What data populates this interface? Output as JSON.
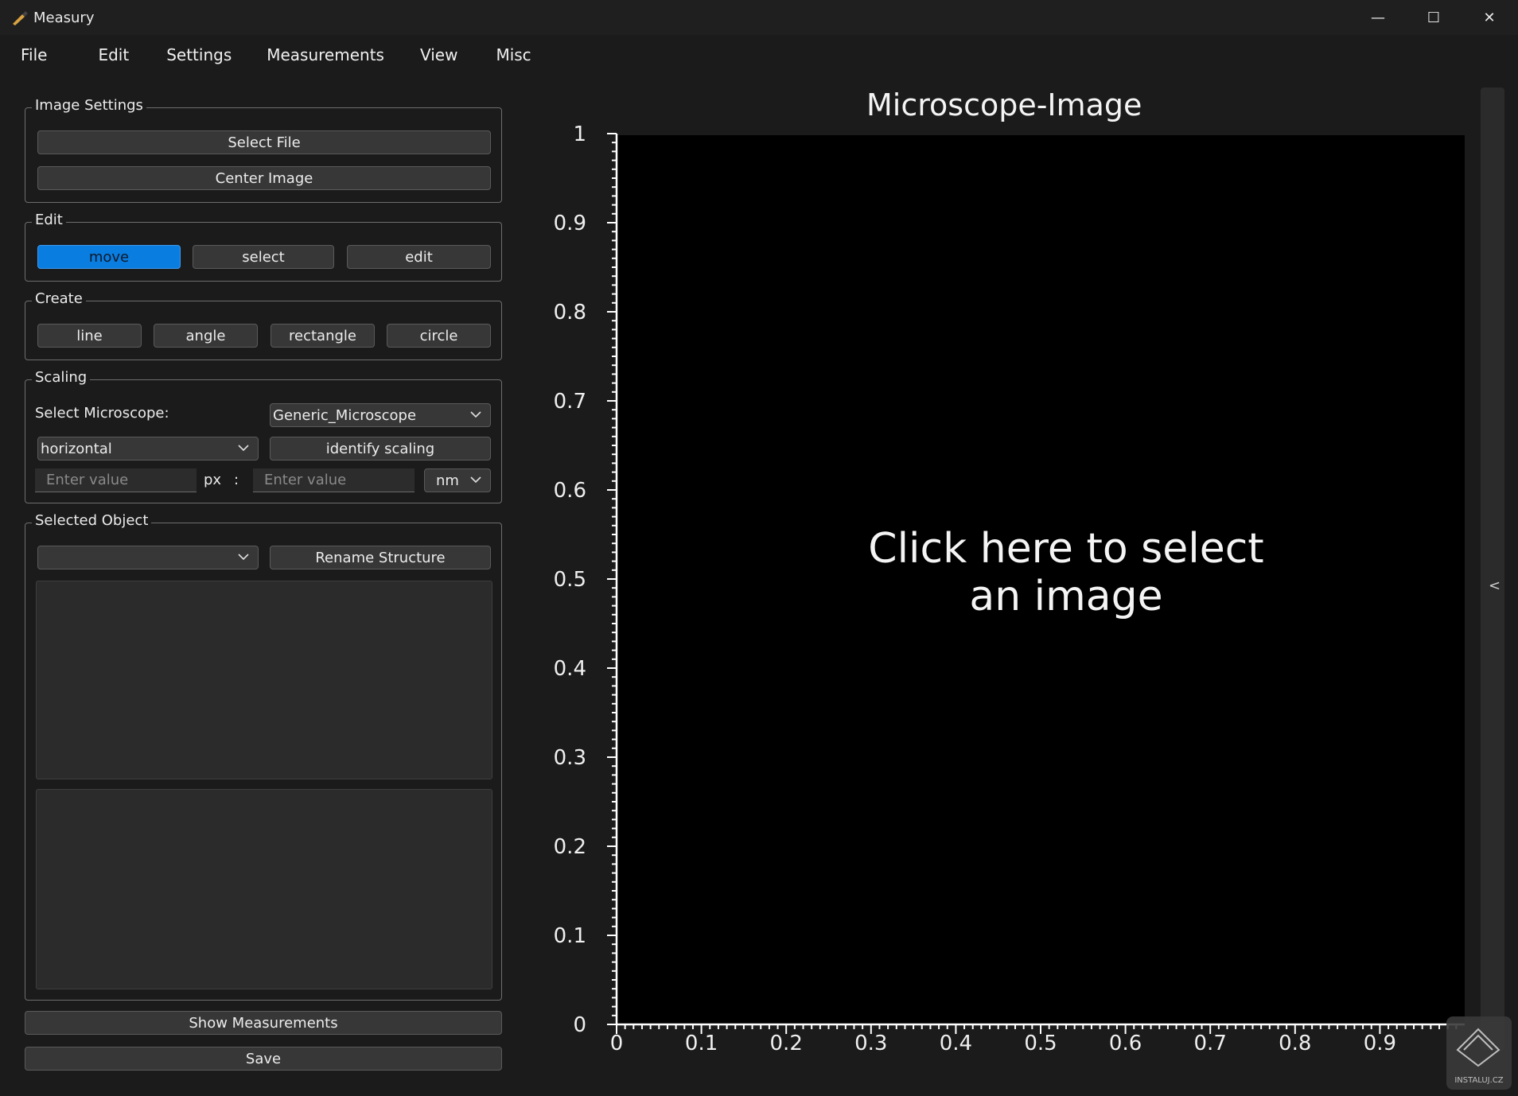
{
  "window": {
    "title": "Measury",
    "minimize_glyph": "—",
    "maximize_glyph": "☐",
    "close_glyph": "✕"
  },
  "menu": [
    "File",
    "Edit",
    "Settings",
    "Measurements",
    "View",
    "Misc"
  ],
  "image_settings": {
    "title": "Image Settings",
    "select_file": "Select File",
    "center_image": "Center Image"
  },
  "edit": {
    "title": "Edit",
    "modes": [
      "move",
      "select",
      "edit"
    ],
    "active_mode": "move"
  },
  "create": {
    "title": "Create",
    "tools": [
      "line",
      "angle",
      "rectangle",
      "circle"
    ]
  },
  "scaling": {
    "title": "Scaling",
    "microscope_label": "Select Microscope:",
    "microscope_value": "Generic_Microscope",
    "direction_value": "horizontal",
    "identify_label": "identify scaling",
    "px_placeholder": "Enter value",
    "px_unit": "px",
    "separator": ":",
    "value_placeholder": "Enter value",
    "unit_value": "nm"
  },
  "selected_object": {
    "title": "Selected Object",
    "structure_value": "",
    "rename_label": "Rename Structure"
  },
  "footer": {
    "show_measurements": "Show Measurements",
    "save": "Save"
  },
  "plot": {
    "title": "Microscope-Image",
    "placeholder_line1": "Click here to select",
    "placeholder_line2": "an image",
    "collapse_glyph": "<",
    "watermark": "INSTALUJ.CZ"
  },
  "chart_data": {
    "type": "scatter",
    "title": "Microscope-Image",
    "xlim": [
      0,
      1
    ],
    "ylim": [
      0,
      1
    ],
    "xticks": [
      "0",
      "0.1",
      "0.2",
      "0.3",
      "0.4",
      "0.5",
      "0.6",
      "0.7",
      "0.8",
      "0.9"
    ],
    "yticks": [
      "0",
      "0.1",
      "0.2",
      "0.3",
      "0.4",
      "0.5",
      "0.6",
      "0.7",
      "0.8",
      "0.9",
      "1"
    ],
    "series": []
  },
  "colors": {
    "accent": "#0a7de0",
    "plot_background": "#000000",
    "window_background": "#1b1b1b"
  }
}
